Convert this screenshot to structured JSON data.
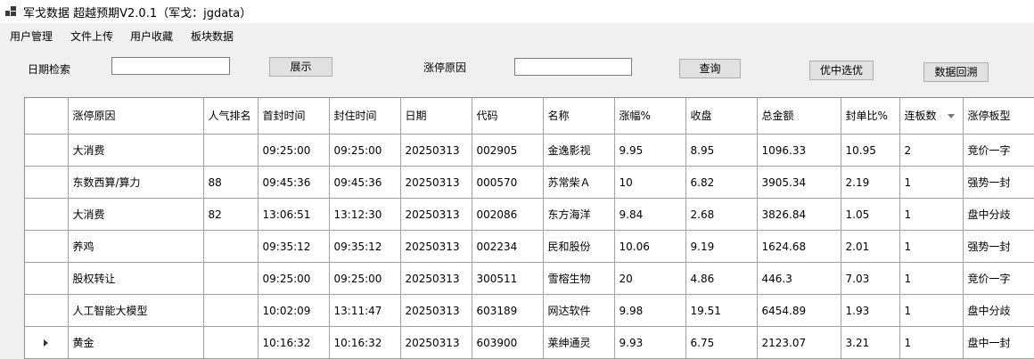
{
  "window": {
    "title": "军戈数据 超越预期V2.0.1（军戈：jgdata）",
    "icon": "window-grid-icon"
  },
  "menu": [
    "用户管理",
    "文件上传",
    "用户收藏",
    "板块数据"
  ],
  "toolbar": {
    "date_label": "日期检索",
    "date_value": "",
    "show_button": "展示",
    "reason_label": "涨停原因",
    "reason_value": "",
    "query_button": "查询",
    "pick_button": "优中选优",
    "backtrack_button": "数据回溯"
  },
  "table": {
    "columns": [
      "涨停原因",
      "人气排名",
      "首封时间",
      "封住时间",
      "日期",
      "代码",
      "名称",
      "涨幅%",
      "收盘",
      "总金额",
      "封单比%",
      "连板数",
      "涨停板型"
    ],
    "sorted_column": "连板数",
    "current_row": 6,
    "rows": [
      [
        "大消费",
        "",
        "09:25:00",
        "09:25:00",
        "20250313",
        "002905",
        "金逸影视",
        "9.95",
        "8.95",
        "1096.33",
        "10.95",
        "2",
        "竞价一字"
      ],
      [
        "东数西算/算力",
        "88",
        "09:45:36",
        "09:45:36",
        "20250313",
        "000570",
        "苏常柴Ａ",
        "10",
        "6.82",
        "3905.34",
        "2.19",
        "1",
        "强势一封"
      ],
      [
        "大消费",
        "82",
        "13:06:51",
        "13:12:30",
        "20250313",
        "002086",
        "东方海洋",
        "9.84",
        "2.68",
        "3826.84",
        "1.05",
        "1",
        "盘中分歧"
      ],
      [
        "养鸡",
        "",
        "09:35:12",
        "09:35:12",
        "20250313",
        "002234",
        "民和股份",
        "10.06",
        "9.19",
        "1624.68",
        "2.01",
        "1",
        "强势一封"
      ],
      [
        "股权转让",
        "",
        "09:25:00",
        "09:25:00",
        "20250313",
        "300511",
        "雪榕生物",
        "20",
        "4.86",
        "446.3",
        "7.03",
        "1",
        "竞价一字"
      ],
      [
        "人工智能大模型",
        "",
        "10:02:09",
        "13:11:47",
        "20250313",
        "603189",
        "网达软件",
        "9.98",
        "19.51",
        "6454.89",
        "1.93",
        "1",
        "盘中分歧"
      ],
      [
        "黄金",
        "",
        "10:16:32",
        "10:16:32",
        "20250313",
        "603900",
        "莱绅通灵",
        "9.93",
        "6.75",
        "2123.07",
        "3.21",
        "1",
        "盘中一封"
      ]
    ]
  }
}
